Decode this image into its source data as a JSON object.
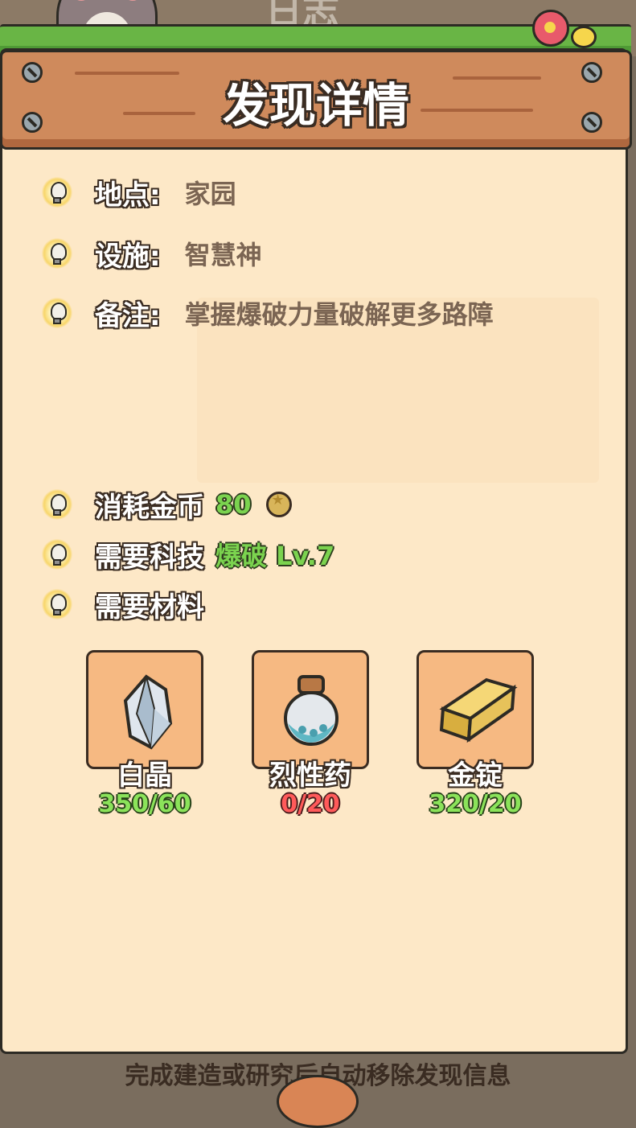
{
  "background": {
    "title_fragment": "日志"
  },
  "header": {
    "title": "发现详情"
  },
  "info": {
    "location_label": "地点:",
    "location_value": "家园",
    "facility_label": "设施:",
    "facility_value": "智慧神",
    "note_label": "备注:",
    "note_value": "掌握爆破力量破解更多路障"
  },
  "requirements": {
    "coins_label": "消耗金币",
    "coins_value": "80",
    "tech_label": "需要科技",
    "tech_value": "爆破 Lv.7",
    "materials_label": "需要材料"
  },
  "materials": [
    {
      "name": "白晶",
      "count": "350/60",
      "status": "enough",
      "icon": "crystal-icon"
    },
    {
      "name": "烈性药",
      "count": "0/20",
      "status": "insufficient",
      "icon": "potion-icon"
    },
    {
      "name": "金锭",
      "count": "320/20",
      "status": "enough",
      "icon": "gold-bar-icon"
    }
  ],
  "footer": {
    "text": "完成建造或研究后自动移除发现信息"
  },
  "colors": {
    "accent_green": "#7bd34f",
    "warning_red": "#ff5a5a",
    "panel_bg": "#fde8c7",
    "plank": "#cf8a5c"
  }
}
